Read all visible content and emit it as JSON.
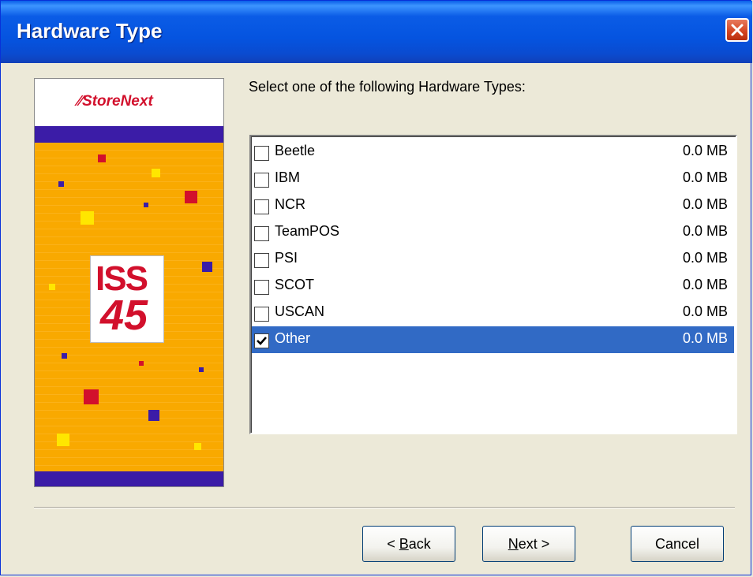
{
  "window": {
    "title": "Hardware Type"
  },
  "banner": {
    "brand": "StoreNext",
    "product_line1": "ISS",
    "product_line2": "45"
  },
  "prompt": "Select one of the following Hardware Types:",
  "items": [
    {
      "label": "Beetle",
      "size": "0.0 MB",
      "checked": false
    },
    {
      "label": "IBM",
      "size": "0.0 MB",
      "checked": false
    },
    {
      "label": "NCR",
      "size": "0.0 MB",
      "checked": false
    },
    {
      "label": "TeamPOS",
      "size": "0.0 MB",
      "checked": false
    },
    {
      "label": "PSI",
      "size": "0.0 MB",
      "checked": false
    },
    {
      "label": "SCOT",
      "size": "0.0 MB",
      "checked": false
    },
    {
      "label": "USCAN",
      "size": "0.0 MB",
      "checked": false
    },
    {
      "label": "Other",
      "size": "0.0 MB",
      "checked": true,
      "selected": true
    }
  ],
  "buttons": {
    "back_prefix": "< ",
    "back_mnemonic": "B",
    "back_rest": "ack",
    "next_mnemonic": "N",
    "next_rest": "ext >",
    "cancel": "Cancel"
  },
  "colors": {
    "titlebar": "#0554e0",
    "selection": "#316ac5",
    "brand_red": "#d2102c",
    "banner_orange": "#f7a800",
    "banner_band": "#3b1ca7"
  }
}
